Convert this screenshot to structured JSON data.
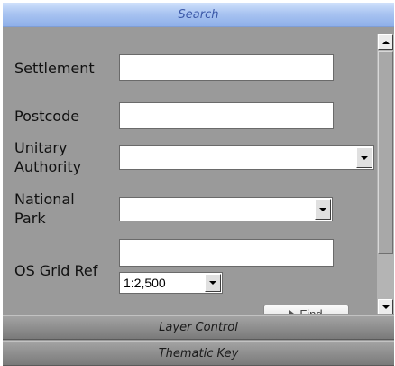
{
  "headers": {
    "search": "Search",
    "layer_control": "Layer Control",
    "thematic_key": "Thematic Key"
  },
  "form": {
    "settlement": {
      "label": "Settlement",
      "value": ""
    },
    "postcode": {
      "label": "Postcode",
      "value": ""
    },
    "unitary_authority": {
      "label_line1": "Unitary",
      "label_line2": "Authority",
      "value": ""
    },
    "national_park": {
      "label_line1": "National",
      "label_line2": "Park",
      "value": ""
    },
    "os_grid_ref": {
      "label": "OS Grid Ref",
      "value": ""
    },
    "scale": {
      "value": "1:2,500"
    },
    "find_label": "Find"
  },
  "icons": {
    "dropdown": "chevron-down-icon",
    "scroll_up": "arrow-up-icon",
    "scroll_down": "arrow-down-icon",
    "find": "play-icon"
  }
}
